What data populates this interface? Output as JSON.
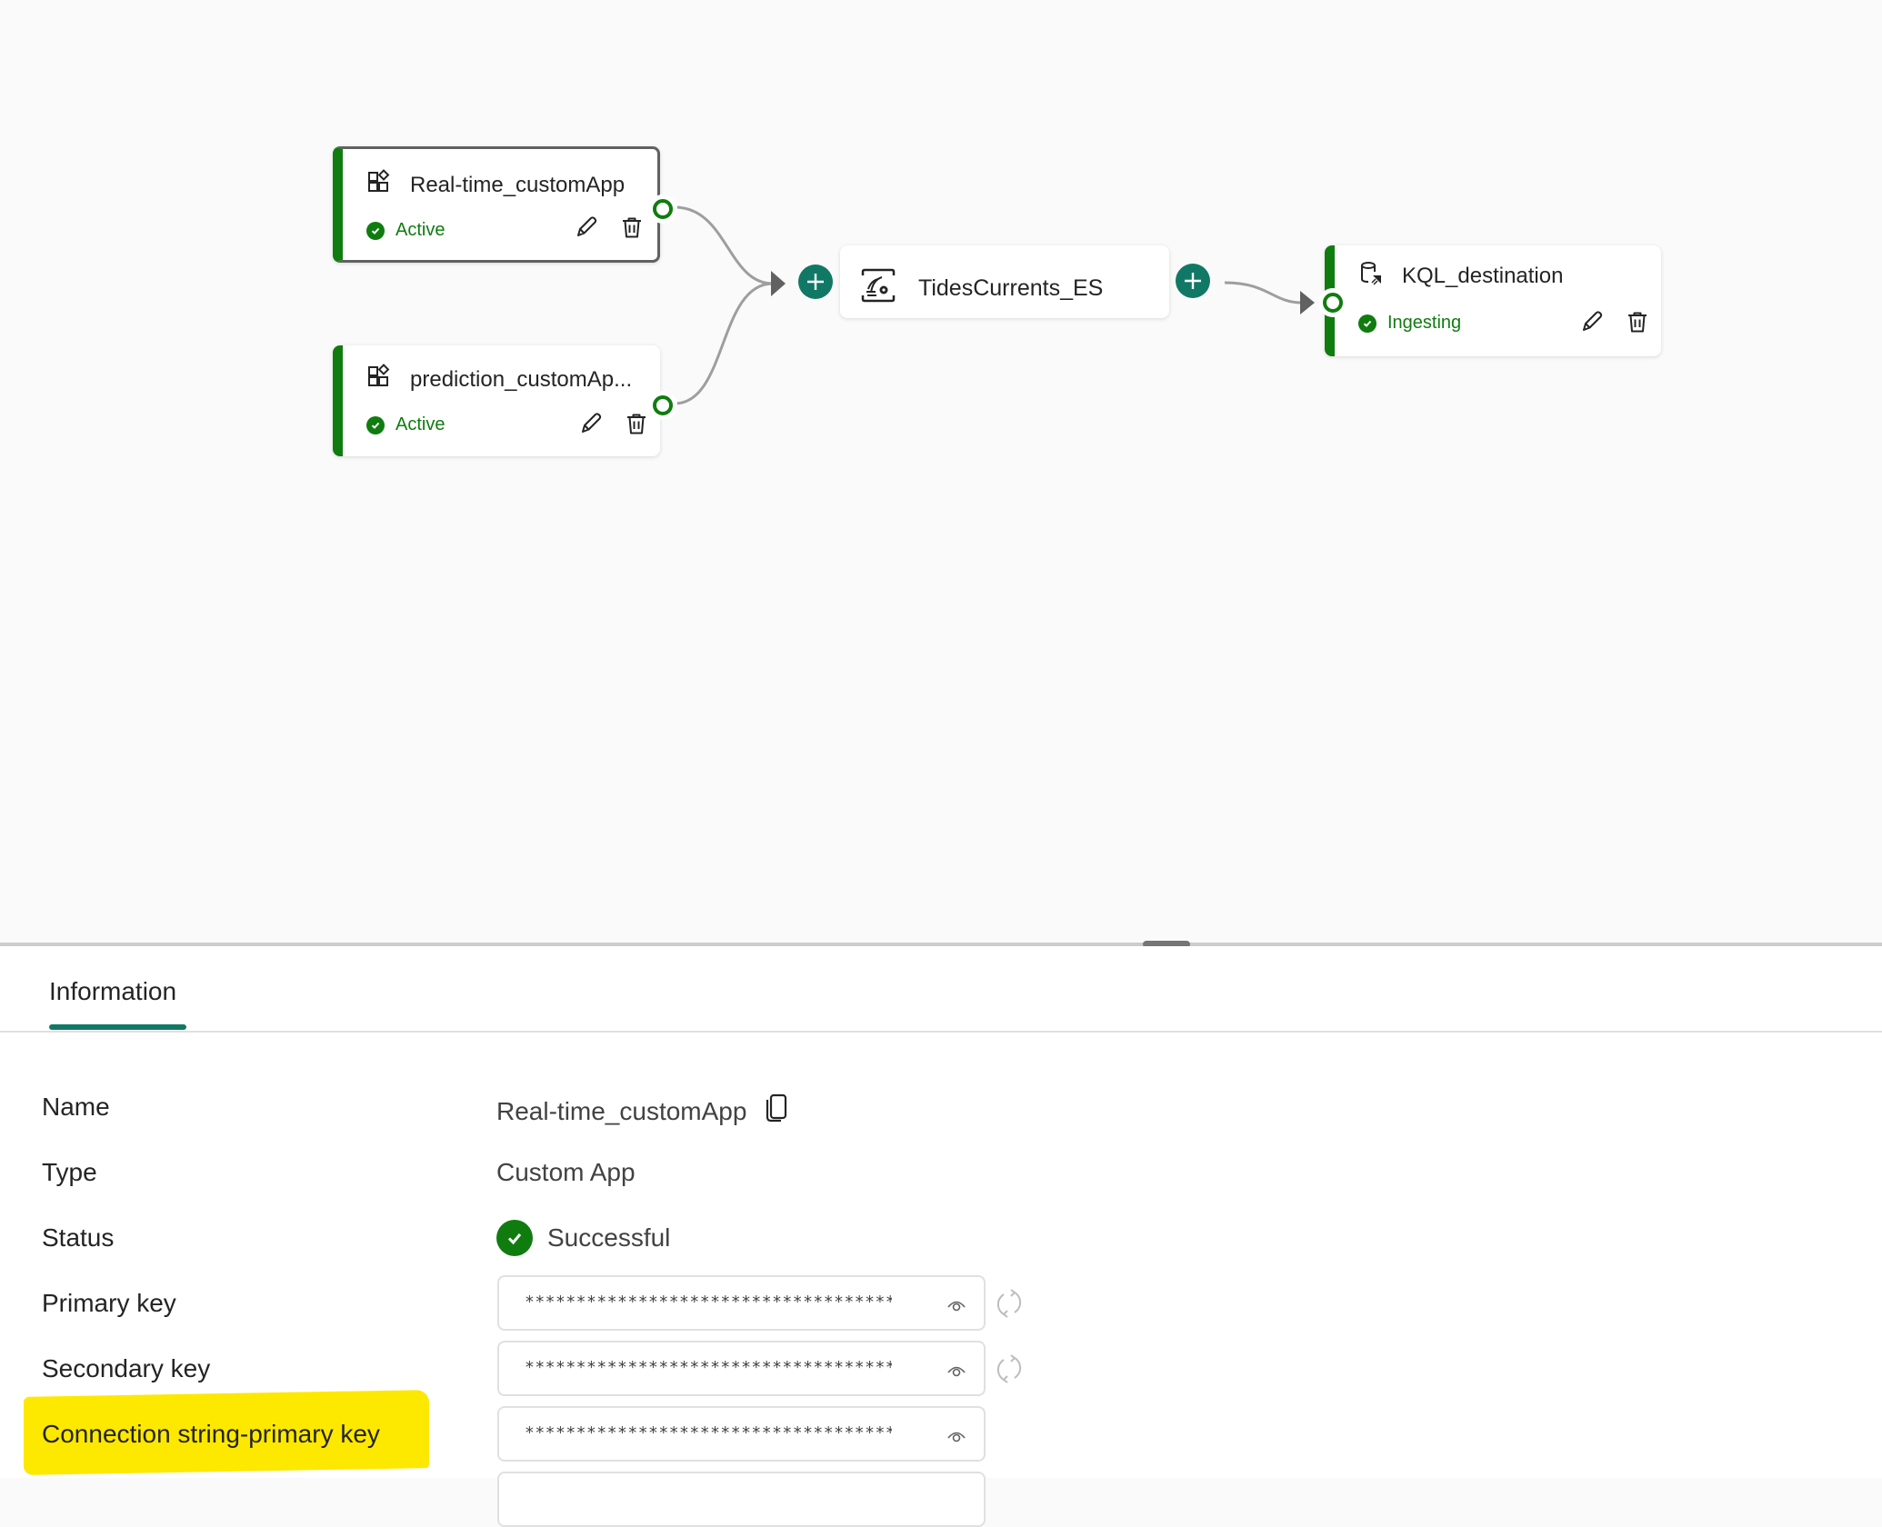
{
  "canvas": {
    "sources": [
      {
        "name": "Real-time_customApp",
        "status": "Active",
        "icon": "custom-app-icon",
        "selected": true
      },
      {
        "name": "prediction_customAp...",
        "status": "Active",
        "icon": "custom-app-icon",
        "selected": false
      }
    ],
    "stream": {
      "name": "TidesCurrents_ES",
      "icon": "eventstream-icon"
    },
    "destination": {
      "name": "KQL_destination",
      "status": "Ingesting",
      "icon": "kql-database-icon"
    },
    "actions": {
      "edit": "edit-icon",
      "delete": "delete-icon",
      "add": "add-icon"
    }
  },
  "colors": {
    "status_green": "#107c10",
    "accent_teal": "#117865",
    "highlight_yellow": "#fde800",
    "canvas_bg": "#fafafa"
  },
  "panel": {
    "tabs": [
      {
        "label": "Information",
        "active": true
      }
    ],
    "rows": [
      {
        "label": "Name",
        "value": "Real-time_customApp"
      },
      {
        "label": "Type",
        "value": "Custom App"
      },
      {
        "label": "Status",
        "value": "Successful"
      },
      {
        "label": "Primary key",
        "value": "*************************************"
      },
      {
        "label": "Secondary key",
        "value": "*************************************"
      },
      {
        "label": "Connection string-primary key",
        "value": "*************************************",
        "highlighted": true
      },
      {
        "label": "",
        "value": ""
      }
    ]
  }
}
